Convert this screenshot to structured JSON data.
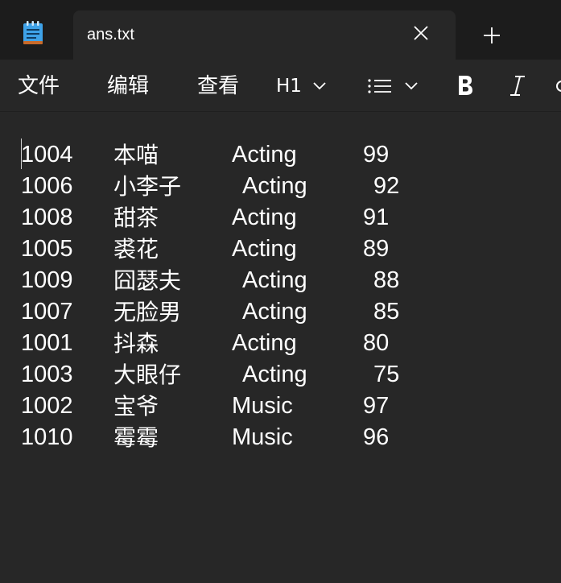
{
  "tab": {
    "title": "ans.txt"
  },
  "icons": {
    "app": "notepad-icon",
    "close": "close-icon",
    "new_tab": "plus-icon",
    "heading_chevron": "chevron-down-icon",
    "list": "bulleted-list-icon",
    "bold": "bold-icon",
    "italic": "italic-icon"
  },
  "menu": {
    "file": "文件",
    "edit": "编辑",
    "view": "查看"
  },
  "format": {
    "heading": "H1"
  },
  "colors": {
    "titlebar": "#1c1c1c",
    "editor_bg": "#272727",
    "text": "#ffffff"
  },
  "document": {
    "rows": [
      {
        "id": "1004",
        "name": "本喵",
        "dept": "Acting",
        "score": "99"
      },
      {
        "id": "1006",
        "name": "小李子",
        "dept": "Acting",
        "score": "92"
      },
      {
        "id": "1008",
        "name": "甜茶",
        "dept": "Acting",
        "score": "91"
      },
      {
        "id": "1005",
        "name": "裘花",
        "dept": "Acting",
        "score": "89"
      },
      {
        "id": "1009",
        "name": "囧瑟夫",
        "dept": "Acting",
        "score": "88"
      },
      {
        "id": "1007",
        "name": "无脸男",
        "dept": "Acting",
        "score": "85"
      },
      {
        "id": "1001",
        "name": "抖森",
        "dept": "Acting",
        "score": "80"
      },
      {
        "id": "1003",
        "name": "大眼仔",
        "dept": "Acting",
        "score": "75"
      },
      {
        "id": "1002",
        "name": "宝爷",
        "dept": "Music",
        "score": "97"
      },
      {
        "id": "1010",
        "name": "霉霉",
        "dept": "Music",
        "score": "96"
      }
    ]
  }
}
